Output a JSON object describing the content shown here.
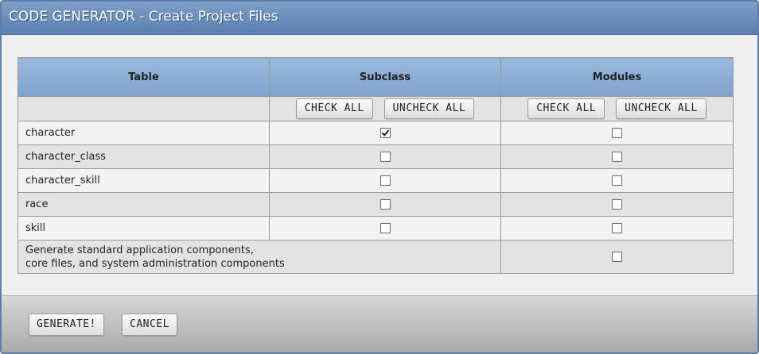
{
  "window": {
    "title": "CODE GENERATOR - Create Project Files"
  },
  "table": {
    "headers": {
      "table": "Table",
      "subclass": "Subclass",
      "modules": "Modules"
    },
    "subclass_buttons": {
      "check_all": "CHECK ALL",
      "uncheck_all": "UNCHECK ALL"
    },
    "modules_buttons": {
      "check_all": "CHECK ALL",
      "uncheck_all": "UNCHECK ALL"
    },
    "rows": [
      {
        "name": "character",
        "subclass": true,
        "modules": false
      },
      {
        "name": "character_class",
        "subclass": false,
        "modules": false
      },
      {
        "name": "character_skill",
        "subclass": false,
        "modules": false
      },
      {
        "name": "race",
        "subclass": false,
        "modules": false
      },
      {
        "name": "skill",
        "subclass": false,
        "modules": false
      }
    ],
    "standard_row": {
      "line1": "Generate standard application components,",
      "line2": "core files, and system administration components",
      "modules": false
    }
  },
  "footer": {
    "generate_label": "GENERATE!",
    "cancel_label": "CANCEL"
  }
}
